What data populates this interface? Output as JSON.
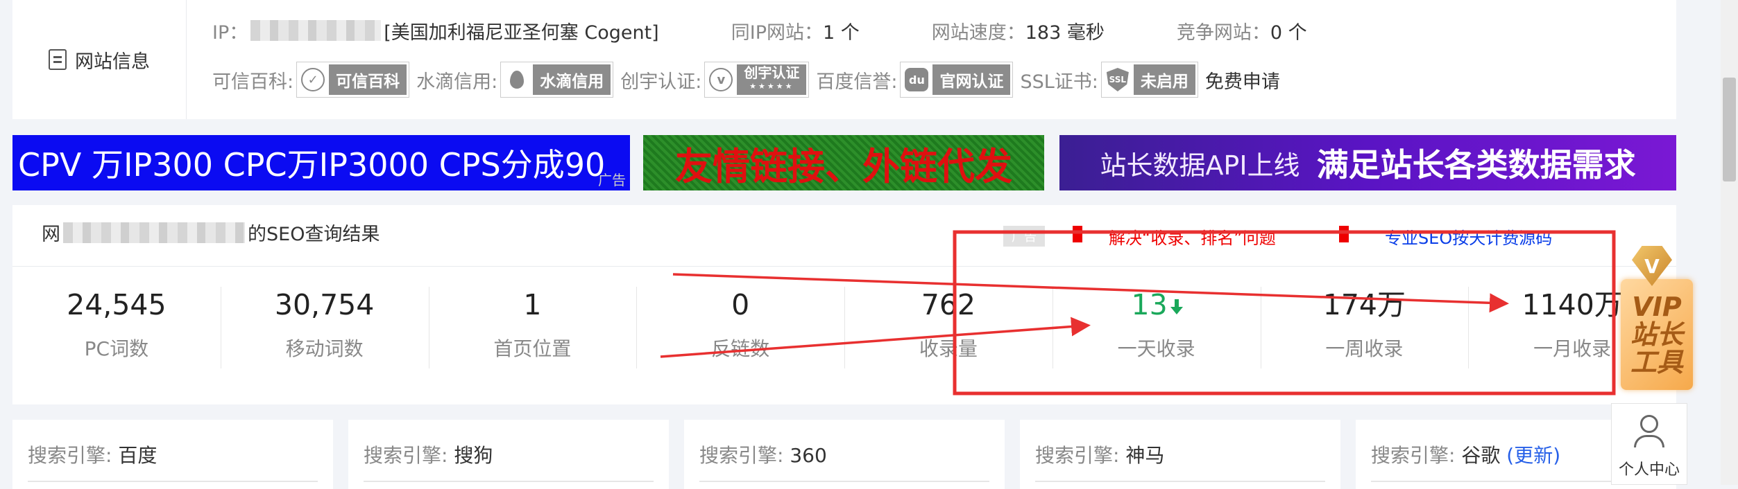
{
  "site_info": {
    "label": "网站信息",
    "ip_label": "IP：",
    "ip_location": "[美国加利福尼亚圣何塞 Cogent]",
    "same_ip_label": "同IP网站：",
    "same_ip_value": "1 个",
    "speed_label": "网站速度：",
    "speed_value": "183 毫秒",
    "competitor_label": "竞争网站：",
    "competitor_value": "0 个",
    "kexin_label": "可信百科:",
    "kexin_badge": "可信百科",
    "shuidi_label": "水滴信用:",
    "shuidi_badge": "水滴信用",
    "chuangyu_label": "创宇认证:",
    "chuangyu_badge": "创宇认证",
    "chuangyu_stars": "★★★★★",
    "baidu_label": "百度信誉:",
    "baidu_badge": "官网认证",
    "baidu_icon_text": "du",
    "ssl_label": "SSL证书:",
    "ssl_badge": "未启用",
    "ssl_icon_text": "SSL",
    "ssl_apply": "免费申请"
  },
  "banners": {
    "b1": "CPV 万IP300 CPC万IP3000 CPS分成90",
    "b1_ad": "广告",
    "b2": "友情链接、外链代发",
    "b3_part1": "站长数据API上线",
    "b3_part2": "满足站长各类数据需求"
  },
  "seo": {
    "title_prefix": "网",
    "title_suffix": "的SEO查询结果",
    "ad_tag": "广告",
    "link1": "解决“收录、排名”问题",
    "link2": "专业SEO按天计费源码"
  },
  "stats": [
    {
      "value": "24,545",
      "label": "PC词数"
    },
    {
      "value": "30,754",
      "label": "移动词数"
    },
    {
      "value": "1",
      "label": "首页位置"
    },
    {
      "value": "0",
      "label": "反链数"
    },
    {
      "value": "762",
      "label": "收录量"
    },
    {
      "value": "13",
      "label": "一天收录"
    },
    {
      "value": "174万",
      "label": "一周收录"
    },
    {
      "value": "1140万",
      "label": "一月收录"
    }
  ],
  "engines": [
    {
      "label": "搜索引擎:",
      "name": "百度"
    },
    {
      "label": "搜索引擎:",
      "name": "搜狗"
    },
    {
      "label": "搜索引擎:",
      "name": "360"
    },
    {
      "label": "搜索引擎:",
      "name": "神马"
    },
    {
      "label": "搜索引擎:",
      "name": "谷歌",
      "extra": "(更新)"
    }
  ],
  "vip": {
    "gem": "V",
    "line1": "VIP",
    "line2": "站长",
    "line3": "工具"
  },
  "user_center": "个人中心",
  "colors": {
    "annotation_red": "#e83030",
    "stat_green": "#1aa85a",
    "banner_blue": "#0b0bf2",
    "banner_purple": "#5a14c4",
    "link_blue": "#0a3ee8"
  }
}
